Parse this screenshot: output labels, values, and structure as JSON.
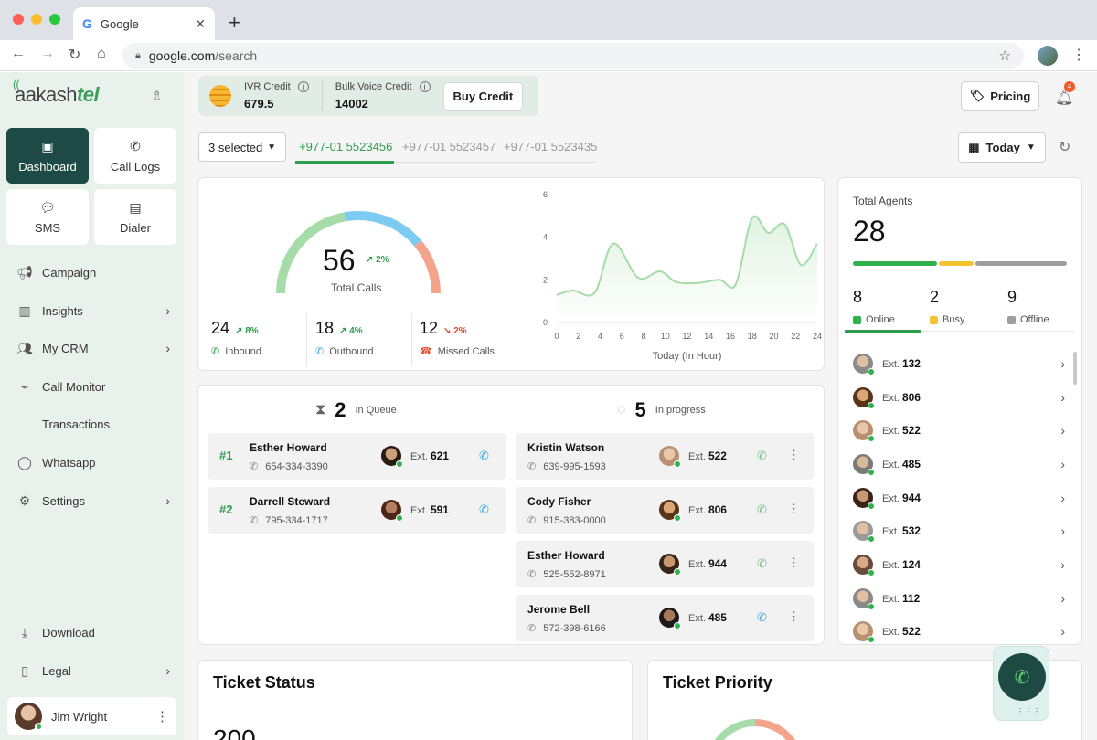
{
  "browser": {
    "tab_title": "Google",
    "url_domain": "google.com",
    "url_path": "/search"
  },
  "sidebar": {
    "logo_plain": "aakash",
    "logo_accent": "tel",
    "tiles": [
      {
        "label": "Dashboard",
        "icon": "folder-heart-icon",
        "active": true
      },
      {
        "label": "Call Logs",
        "icon": "phone-icon",
        "active": false
      },
      {
        "label": "SMS",
        "icon": "sms-bubble-icon",
        "active": false
      },
      {
        "label": "Dialer",
        "icon": "dialer-folder-icon",
        "active": false
      }
    ],
    "items": [
      {
        "label": "Campaign",
        "icon": "megaphone-icon",
        "chevron": false
      },
      {
        "label": "Insights",
        "icon": "bar-chart-icon",
        "chevron": true
      },
      {
        "label": "My CRM",
        "icon": "users-icon",
        "chevron": true
      },
      {
        "label": "Call Monitor",
        "icon": "monitor-pulse-icon",
        "chevron": false
      },
      {
        "label": "Transactions",
        "icon": "",
        "chevron": false
      },
      {
        "label": "Whatsapp",
        "icon": "whatsapp-icon",
        "chevron": false
      },
      {
        "label": "Settings",
        "icon": "gear-icon",
        "chevron": true
      },
      {
        "label": "Download",
        "icon": "download-icon",
        "chevron": false
      },
      {
        "label": "Legal",
        "icon": "document-icon",
        "chevron": true
      }
    ],
    "user": {
      "name": "Jim Wright"
    }
  },
  "topbar": {
    "ivr_label": "IVR Credit",
    "ivr_value": "679.5",
    "bulk_label": "Bulk Voice Credit",
    "bulk_value": "14002",
    "buy_label": "Buy Credit",
    "pricing_label": "Pricing",
    "notifications_count": "4"
  },
  "filters": {
    "selected_label": "3 selected",
    "numbers": [
      "+977-01 5523456",
      "+977-01 5523457",
      "+977-01 5523435"
    ],
    "active_number_index": 0,
    "date_label": "Today"
  },
  "calls": {
    "total": "56",
    "total_delta": "2%",
    "total_label": "Total Calls",
    "inbound": {
      "value": "24",
      "delta": "8%",
      "label": "Inbound"
    },
    "outbound": {
      "value": "18",
      "delta": "4%",
      "label": "Outbound"
    },
    "missed": {
      "value": "12",
      "delta": "2%",
      "label": "Missed Calls"
    },
    "gauge_colors": {
      "inbound": "#a6dca9",
      "outbound": "#7ccbf0",
      "missed": "#f4a48a"
    }
  },
  "chart_data": {
    "type": "area",
    "xlabel": "Today (In Hour)",
    "ylabel": "",
    "x_ticks": [
      0,
      2,
      4,
      6,
      8,
      10,
      12,
      14,
      16,
      18,
      20,
      22,
      24
    ],
    "y_ticks": [
      0,
      2,
      4,
      6
    ],
    "ylim": [
      0,
      6
    ],
    "xlim": [
      0,
      24
    ],
    "series": [
      {
        "values": [
          [
            0,
            1.3
          ],
          [
            1.5,
            1.5
          ],
          [
            3.5,
            1.4
          ],
          [
            5.2,
            3.7
          ],
          [
            7.5,
            2.1
          ],
          [
            9.5,
            2.4
          ],
          [
            11,
            1.9
          ],
          [
            13,
            1.85
          ],
          [
            15,
            2.0
          ],
          [
            16.5,
            1.8
          ],
          [
            18,
            4.9
          ],
          [
            19.5,
            4.2
          ],
          [
            21,
            4.6
          ],
          [
            22.5,
            2.7
          ],
          [
            24,
            3.7
          ]
        ],
        "color": "#a6dca9"
      }
    ],
    "grid": false
  },
  "queue": {
    "in_queue_count": "2",
    "in_queue_label": "In Queue",
    "in_progress_count": "5",
    "in_progress_label": "In progress",
    "queued": [
      {
        "rank": "#1",
        "name": "Esther Howard",
        "phone": "654-334-3390",
        "ext": "621"
      },
      {
        "rank": "#2",
        "name": "Darrell Steward",
        "phone": "795-334-1717",
        "ext": "591"
      }
    ],
    "ext_label": "Ext.",
    "active": [
      {
        "name": "Kristin Watson",
        "phone": "639-995-1593",
        "ext": "522",
        "call": "outgoing"
      },
      {
        "name": "Cody Fisher",
        "phone": "915-383-0000",
        "ext": "806",
        "call": "outgoing"
      },
      {
        "name": "Esther Howard",
        "phone": "525-552-8971",
        "ext": "944",
        "call": "outgoing"
      },
      {
        "name": "Jerome Bell",
        "phone": "572-398-6166",
        "ext": "485",
        "call": "incoming"
      }
    ]
  },
  "agents": {
    "title": "Total Agents",
    "total": "28",
    "online": {
      "value": "8",
      "label": "Online",
      "color": "#2fb24c"
    },
    "busy": {
      "value": "2",
      "label": "Busy",
      "color": "#f4c430"
    },
    "offline": {
      "value": "9",
      "label": "Offline",
      "color": "#9e9e9e"
    },
    "ext_label": "Ext.",
    "list": [
      "132",
      "806",
      "522",
      "485",
      "944",
      "532",
      "124",
      "112",
      "522"
    ]
  },
  "tickets": {
    "status_title": "Ticket Status",
    "status_number_partial": "200",
    "priority_title": "Ticket Priority"
  }
}
